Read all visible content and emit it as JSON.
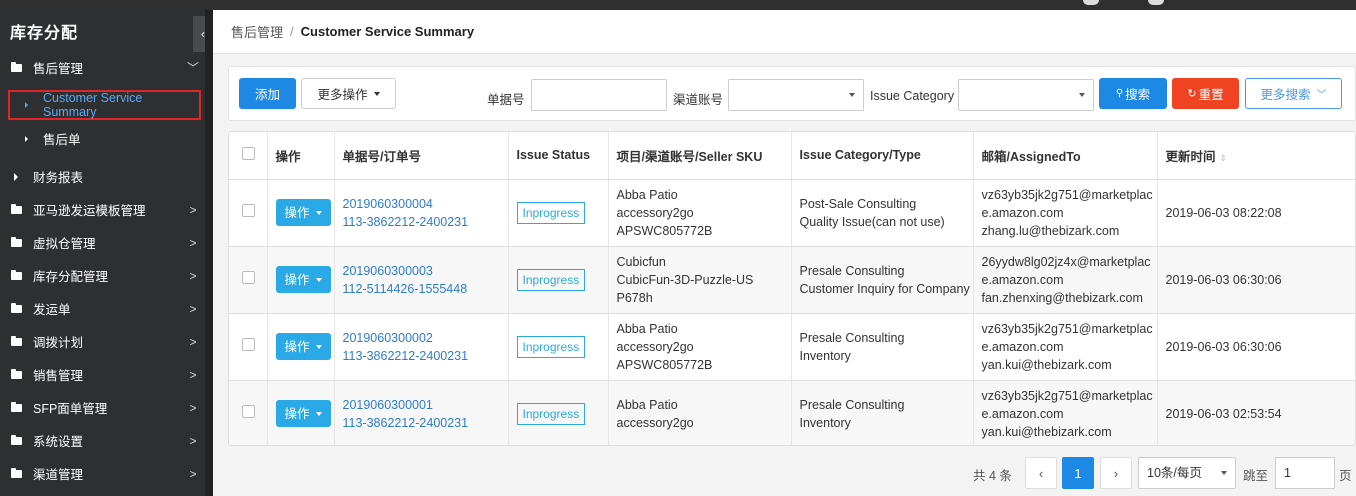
{
  "sidebar": {
    "brand": "库存分配",
    "collapse_icon": "chevron-left-icon",
    "menu": [
      {
        "label": "售后管理",
        "arrow": "﹀"
      },
      {
        "label": "Customer Service Summary"
      },
      {
        "label": "售后单"
      },
      {
        "label": "财务报表"
      },
      {
        "label": "亚马逊发运模板管理",
        "arrow": ">"
      },
      {
        "label": "虚拟仓管理",
        "arrow": ">"
      },
      {
        "label": "库存分配管理",
        "arrow": ">"
      },
      {
        "label": "发运单",
        "arrow": ">"
      },
      {
        "label": "调拨计划",
        "arrow": ">"
      },
      {
        "label": "销售管理",
        "arrow": ">"
      },
      {
        "label": "SFP面单管理",
        "arrow": ">"
      },
      {
        "label": "系统设置",
        "arrow": ">"
      },
      {
        "label": "渠道管理",
        "arrow": ">"
      }
    ]
  },
  "breadcrumb": {
    "parent": "售后管理",
    "separator": "/",
    "current": "Customer Service Summary"
  },
  "toolbar": {
    "add_label": "添加",
    "more_ops_label": "更多操作",
    "doc_no_label": "单据号",
    "doc_no_value": "",
    "channel_label": "渠道账号",
    "channel_value": "",
    "category_label": "Issue Category",
    "category_value": "",
    "search_label": "搜索",
    "reset_label": "重置",
    "more_search_label": "更多搜索"
  },
  "table": {
    "headers": [
      "操作",
      "单据号/订单号",
      "Issue Status",
      "项目/渠道账号/Seller SKU",
      "Issue Category/Type",
      "邮箱/AssignedTo",
      "更新时间"
    ],
    "op_label": "操作",
    "rows": [
      {
        "doc": "2019060300004",
        "order": "113-3862212-2400231",
        "status": "Inprogress",
        "proj": "Abba Patio",
        "channel": "accessory2go",
        "sku": "APSWC805772B",
        "category": "Post-Sale Consulting",
        "type": "Quality Issue(can not use)",
        "email1": "vz63yb35jk2g751@marketplac",
        "email2": "e.amazon.com",
        "assigned": "zhang.lu@thebizark.com",
        "updated": "2019-06-03 08:22:08"
      },
      {
        "doc": "2019060300003",
        "order": "112-5114426-1555448",
        "status": "Inprogress",
        "proj": "Cubicfun",
        "channel": "CubicFun-3D-Puzzle-US",
        "sku": "P678h",
        "category": "Presale Consulting",
        "type": "Customer Inquiry for Company",
        "email1": "26yydw8lg02jz4x@marketplac",
        "email2": "e.amazon.com",
        "assigned": "fan.zhenxing@thebizark.com",
        "updated": "2019-06-03 06:30:06"
      },
      {
        "doc": "2019060300002",
        "order": "113-3862212-2400231",
        "status": "Inprogress",
        "proj": "Abba Patio",
        "channel": "accessory2go",
        "sku": "APSWC805772B",
        "category": "Presale Consulting",
        "type": "Inventory",
        "email1": "vz63yb35jk2g751@marketplac",
        "email2": "e.amazon.com",
        "assigned": "yan.kui@thebizark.com",
        "updated": "2019-06-03 06:30:06"
      },
      {
        "doc": "2019060300001",
        "order": "113-3862212-2400231",
        "status": "Inprogress",
        "proj": "Abba Patio",
        "channel": "accessory2go",
        "sku": "",
        "category": "Presale Consulting",
        "type": "Inventory",
        "email1": "vz63yb35jk2g751@marketplac",
        "email2": "e.amazon.com",
        "assigned": "yan.kui@thebizark.com",
        "updated": "2019-06-03 02:53:54"
      }
    ]
  },
  "pager": {
    "total_label": "共 4 条",
    "prev": "‹",
    "current_page": "1",
    "next": "›",
    "page_size": "10条/每页",
    "jump_label": "跳至",
    "jump_value": "1",
    "page_unit": "页"
  },
  "colors": {
    "primary": "#1e88e5",
    "danger": "#ef4322",
    "accent": "#29aae6",
    "sidebar": "#2e2f31"
  }
}
